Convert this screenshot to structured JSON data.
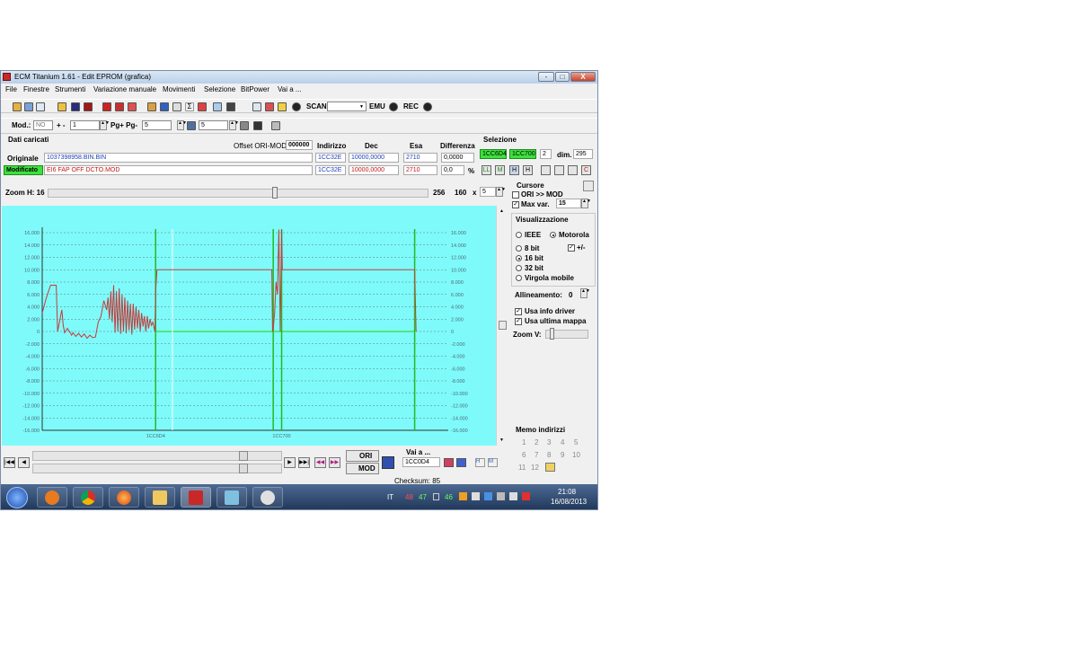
{
  "window": {
    "title": "ECM Titanium 1.61 - Edit EPROM (grafica)",
    "caption_buttons": {
      "minimize": "-",
      "maximize": "□",
      "close": "X"
    }
  },
  "menu": [
    "File",
    "Finestre",
    "Strumenti",
    "Variazione manuale",
    "Movimenti",
    "Selezione",
    "BitPower",
    "Vai a ..."
  ],
  "toolbar1": {
    "scan_label": "SCAN",
    "emu_label": "EMU",
    "rec_label": "REC"
  },
  "toolbar2": {
    "mod_label": "Mod.:",
    "mod_value": "NO",
    "plusminus_label": "+ -",
    "step_value": "1",
    "pg_label": "Pg+ Pg-",
    "pg_value": "5",
    "p_value": "5"
  },
  "data_panel": {
    "title": "Dati caricati",
    "offset_label": "Offset ORI-MOD",
    "offset_value": "000000",
    "col_indirizzo": "Indirizzo",
    "col_dec": "Dec",
    "col_esa": "Esa",
    "col_differenza": "Differenza",
    "originale_label": "Originale",
    "originale_file": "1037398958.BIN.BIN",
    "originale_addr": "1CC32E",
    "originale_dec": "10000,0000",
    "originale_esa": "2710",
    "originale_diff": "0,0000",
    "modificato_label": "Modificato",
    "modificato_file": "EI6 FAP OFF DCTO.MOD",
    "modificato_addr": "1CC32E",
    "modificato_dec": "10000,0000",
    "modificato_esa": "2710",
    "modificato_diff": "0,0",
    "percent_sign": "%"
  },
  "selezione": {
    "title": "Selezione",
    "from": "1CC6D4",
    "to": "1CC700",
    "count": "2",
    "dim_label": "dim.",
    "dim_value": "295"
  },
  "zoom": {
    "label": "Zoom H: 16",
    "v1": "256",
    "v2": "160",
    "x": "x",
    "v3": "5"
  },
  "chart_data": {
    "type": "line",
    "y_ticks_left": [
      "16.000",
      "14.000",
      "12.000",
      "10.000",
      "8.000",
      "6.000",
      "4.000",
      "2.000",
      "0",
      "-2.000",
      "-4.000",
      "-6.000",
      "-8.000",
      "-10.000",
      "-12.000",
      "-14.000",
      "-16.000"
    ],
    "y_ticks_right": [
      "16.000",
      "14.000",
      "12.000",
      "10.000",
      "8.000",
      "6.000",
      "4.000",
      "2.000",
      "0",
      "-2.000",
      "-4.000",
      "-6.000",
      "-8.000",
      "-10.000",
      "-12.000",
      "-14.000",
      "-16.000"
    ],
    "x_labels": [
      "1CC6D4",
      "1CC700"
    ],
    "ylim": [
      -16000,
      16000
    ],
    "xlim": [
      0,
      290
    ],
    "grid": true,
    "colors": {
      "background": "#7ffafa",
      "series": "#c43c3c",
      "baseline": "#33dd33",
      "markers": "#22bb22",
      "cursor": "#ffffff",
      "grid": "#444444"
    },
    "markers_x": [
      81,
      165,
      171,
      266
    ],
    "cursor_x": [
      93
    ],
    "series": [
      {
        "x": [
          0,
          3,
          6,
          9,
          10,
          11,
          14,
          15,
          16,
          18,
          20,
          21,
          22,
          24,
          26,
          28,
          30,
          32,
          34,
          36,
          38,
          40,
          42,
          44,
          46,
          47,
          48,
          49,
          50,
          51,
          52,
          53,
          54,
          55,
          56,
          57,
          58,
          59,
          60,
          61,
          62,
          63,
          64,
          65,
          66,
          67,
          68,
          69,
          70,
          71,
          72,
          73,
          74,
          75,
          76,
          77,
          78,
          79,
          80,
          80.5,
          81,
          82,
          90,
          100,
          120,
          140,
          160,
          164,
          164.5,
          165,
          166,
          167,
          168,
          169,
          170,
          171,
          171.5,
          172,
          180,
          200,
          220,
          240,
          260,
          266,
          267
        ],
        "y": [
          3000,
          5500,
          7500,
          7500,
          7500,
          0,
          3500,
          1000,
          -200,
          500,
          -200,
          -600,
          -200,
          -800,
          -300,
          -900,
          -400,
          -1100,
          -600,
          -1000,
          -900,
          1500,
          2500,
          5000,
          3500,
          5500,
          2000,
          6500,
          1500,
          7500,
          -200,
          6500,
          0,
          7000,
          -400,
          6000,
          0,
          5500,
          -300,
          5000,
          200,
          4500,
          -500,
          4500,
          300,
          4000,
          500,
          3500,
          0,
          3000,
          800,
          2500,
          0,
          2500,
          500,
          2000,
          1000,
          1500,
          500,
          0,
          6500,
          10000,
          10000,
          10000,
          10000,
          10000,
          10000,
          10000,
          0,
          500,
          3000,
          8000,
          6000,
          16500,
          0,
          16500,
          10000,
          10000,
          10000,
          10000,
          10000,
          10000,
          10000,
          10000,
          0
        ]
      }
    ]
  },
  "nav": {
    "ori_label": "ORI",
    "mod_label": "MOD",
    "vai_label": "Vai a ...",
    "vai_value": "1CC0D4"
  },
  "right_panel": {
    "cursore_title": "Cursore",
    "ori_mod_label": "ORI >> MOD",
    "max_var_label": "Max var.",
    "max_var_value": "15",
    "visual_title": "Visualizzazione",
    "ieee_label": "IEEE",
    "motorola_label": "Motorola",
    "bit8_label": "8 bit",
    "plusminus_label": "+/-",
    "bit16_label": "16 bit",
    "bit32_label": "32 bit",
    "virgola_label": "Virgola mobile",
    "allineamento_label": "Allineamento:",
    "allineamento_value": "0",
    "usa_info_label": "Usa info driver",
    "usa_ultima_label": "Usa ultima mappa",
    "zoomv_label": "Zoom V:"
  },
  "memo": {
    "title": "Memo indirizzi",
    "nums": [
      "1",
      "2",
      "3",
      "4",
      "5",
      "6",
      "7",
      "8",
      "9",
      "10",
      "11",
      "12"
    ]
  },
  "status": {
    "checksum": "Checksum: 85"
  },
  "taskbar": {
    "lang": "IT",
    "tray_n1": "48",
    "tray_n2": "47",
    "tray_n3": "46",
    "time": "21:08",
    "date": "16/08/2013"
  }
}
